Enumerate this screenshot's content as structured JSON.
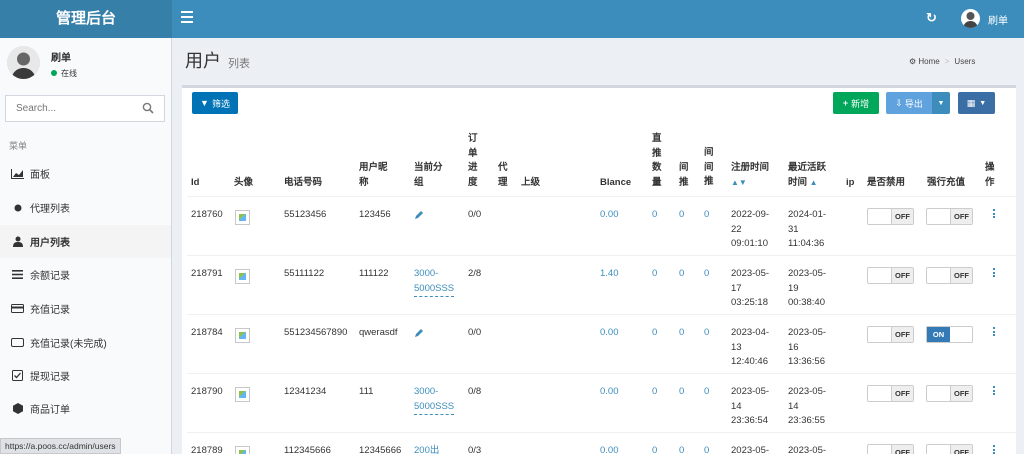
{
  "header": {
    "logo": "管理后台",
    "username": "刷单"
  },
  "sidebar": {
    "username": "刷单",
    "status": "在线",
    "search_placeholder": "Search...",
    "menu_header": "菜单",
    "items": [
      {
        "label": "面板",
        "icon": "chart-area-icon"
      },
      {
        "label": "代理列表",
        "icon": "circle-icon"
      },
      {
        "label": "用户列表",
        "icon": "user-icon"
      },
      {
        "label": "余额记录",
        "icon": "list-icon"
      },
      {
        "label": "充值记录",
        "icon": "credit-card-icon"
      },
      {
        "label": "充值记录(未完成)",
        "icon": "rectangle-icon"
      },
      {
        "label": "提现记录",
        "icon": "checkbox-icon"
      },
      {
        "label": "商品订单",
        "icon": "cube-icon"
      }
    ],
    "active_index": 2
  },
  "status_bar_url": "https://a.poos.cc/admin/users",
  "content": {
    "title": "用户",
    "subtitle": "列表",
    "breadcrumb": [
      "Home",
      "Users"
    ]
  },
  "toolbar": {
    "filter_label": "筛选",
    "add_label": "新增",
    "export_label": "导出"
  },
  "table": {
    "columns": [
      "Id",
      "头像",
      "电话号码",
      "用户昵\n称",
      "当前分\n组",
      "订\n单\n进\n度",
      "代\n理",
      "上级",
      "Blance",
      "直\n推\n数\n量",
      "间\n推",
      "间\n间\n推",
      "注册时间",
      "最近活跃\n时间",
      "ip",
      "是否禁用",
      "强行充值",
      "操\n作"
    ],
    "rows": [
      {
        "id": "218760",
        "phone": "55123456",
        "nickname": "123456",
        "group": "",
        "group_editable": true,
        "progress": "0/0",
        "agent": "",
        "parent": "",
        "balance": "0.00",
        "direct": "0",
        "indirect": "0",
        "indirect2": "0",
        "registered": "2022-09-\n22\n09:01:10",
        "last_active": "2024-01-\n31\n11:04:36",
        "ip": "",
        "disabled": "OFF",
        "force": "OFF"
      },
      {
        "id": "218791",
        "phone": "55111122",
        "nickname": "111122",
        "group": "3000-\n5000SSS",
        "group_editable": false,
        "progress": "2/8",
        "agent": "",
        "parent": "",
        "balance": "1.40",
        "direct": "0",
        "indirect": "0",
        "indirect2": "0",
        "registered": "2023-05-\n17\n03:25:18",
        "last_active": "2023-05-\n19\n00:38:40",
        "ip": "",
        "disabled": "OFF",
        "force": "OFF"
      },
      {
        "id": "218784",
        "phone": "551234567890",
        "nickname": "qwerasdf",
        "group": "",
        "group_editable": true,
        "progress": "0/0",
        "agent": "",
        "parent": "",
        "balance": "0.00",
        "direct": "0",
        "indirect": "0",
        "indirect2": "0",
        "registered": "2023-04-\n13\n12:40:46",
        "last_active": "2023-05-\n16\n13:36:56",
        "ip": "",
        "disabled": "OFF",
        "force": "ON"
      },
      {
        "id": "218790",
        "phone": "12341234",
        "nickname": "111",
        "group": "3000-\n5000SSS",
        "group_editable": false,
        "progress": "0/8",
        "agent": "",
        "parent": "",
        "balance": "0.00",
        "direct": "0",
        "indirect": "0",
        "indirect2": "0",
        "registered": "2023-05-\n14\n23:36:54",
        "last_active": "2023-05-\n14\n23:36:55",
        "ip": "",
        "disabled": "OFF",
        "force": "OFF"
      },
      {
        "id": "218789",
        "phone": "112345666",
        "nickname": "12345666",
        "group": "200出",
        "group_editable": false,
        "progress": "0/3",
        "agent": "",
        "parent": "",
        "balance": "0.00",
        "direct": "0",
        "indirect": "0",
        "indirect2": "0",
        "registered": "2023-05-",
        "last_active": "2023-05-",
        "ip": "",
        "disabled": "OFF",
        "force": "OFF"
      }
    ]
  }
}
